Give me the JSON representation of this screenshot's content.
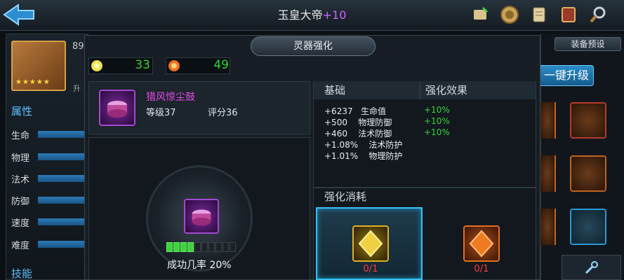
{
  "header": {
    "title": "玉皇大帝",
    "title_plus": "+10"
  },
  "hero": {
    "level": "89",
    "up_label": "升",
    "stars": "★★★★★",
    "attr_section": "属性",
    "attrs": [
      "生命",
      "物理",
      "法术",
      "防御",
      "速度",
      "难度"
    ],
    "skill_section": "技能"
  },
  "right_panel": {
    "preset_label": "装备预设",
    "upgrade_label": "一键升级"
  },
  "modal": {
    "title": "灵器强化",
    "resources": [
      {
        "icon": "spirit-orb-icon",
        "value": "33"
      },
      {
        "icon": "fire-orb-icon",
        "value": "49"
      }
    ],
    "item": {
      "name": "猎风惊尘鼓",
      "level": "等级37",
      "score": "评分36"
    },
    "success_rate": "成功几率 20%",
    "progress": {
      "filled": 4,
      "total": 10
    },
    "stats": {
      "base_header": "基础",
      "bonus_header": "强化效果",
      "rows": [
        {
          "base": "+6237   生命值",
          "bonus": "+10%"
        },
        {
          "base": "+500    物理防御",
          "bonus": "+10%"
        },
        {
          "base": "+460    法术防御",
          "bonus": "+10%"
        },
        {
          "base": "+1.08%    法术防护",
          "bonus": ""
        },
        {
          "base": "+1.01%    物理防护",
          "bonus": ""
        }
      ]
    },
    "cost": {
      "title": "强化消耗",
      "items": [
        {
          "icon": "gold-crystal-icon",
          "count": "0/1"
        },
        {
          "icon": "flame-crystal-icon",
          "count": "0/1"
        }
      ]
    }
  },
  "colors": {
    "accent_blue": "#35c2f0",
    "positive_green": "#3ad43a",
    "insufficient_red": "#ff3c3c",
    "item_purple": "#e44ae8"
  }
}
